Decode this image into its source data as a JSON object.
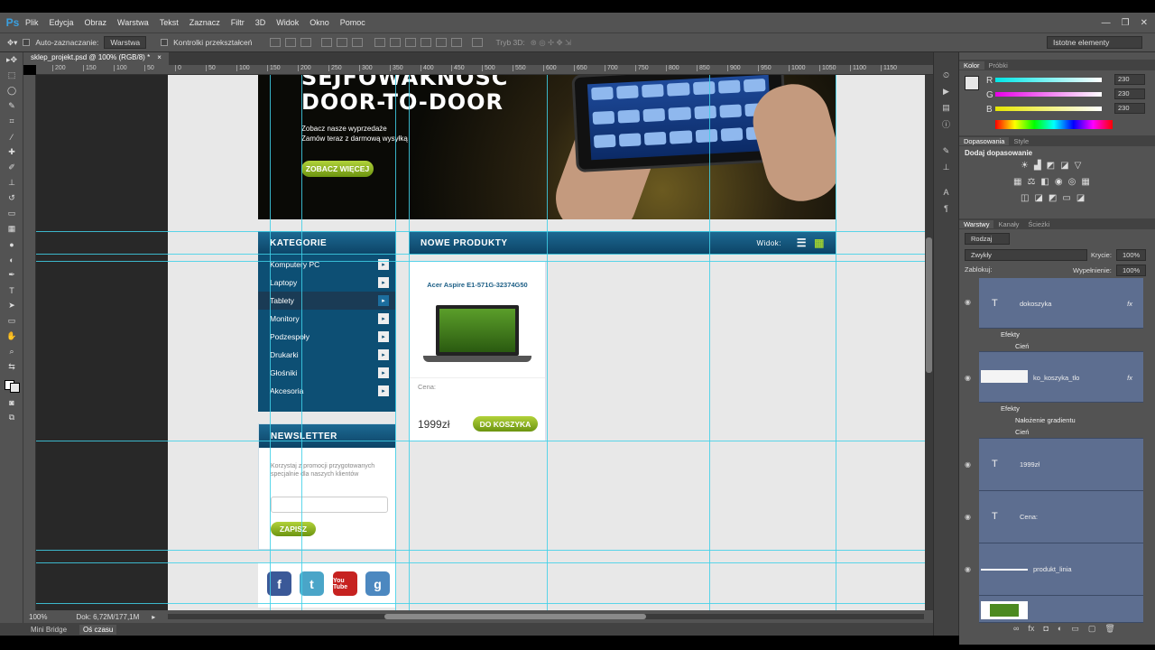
{
  "app": {
    "logo": "Ps",
    "window_controls": [
      "—",
      "❐",
      "✕"
    ]
  },
  "menu": [
    "Plik",
    "Edycja",
    "Obraz",
    "Warstwa",
    "Tekst",
    "Zaznacz",
    "Filtr",
    "3D",
    "Widok",
    "Okno",
    "Pomoc"
  ],
  "options": {
    "auto_select": "Auto-zaznaczanie:",
    "layer_select": "Warstwa",
    "transform": "Kontrolki przekształceń",
    "mode3d": "Tryb 3D:",
    "workspace": "Istotne elementy"
  },
  "document": {
    "tab_title": "sklep_projekt.psd @ 100% (RGB/8) *",
    "close": "×"
  },
  "ruler": {
    "ticks": [
      "200",
      "150",
      "100",
      "50",
      "0",
      "50",
      "100",
      "150",
      "200",
      "250",
      "300",
      "350",
      "400",
      "450",
      "500",
      "550",
      "600",
      "650",
      "700",
      "750",
      "800",
      "850",
      "900",
      "950",
      "1000",
      "1050",
      "1100",
      "1150"
    ]
  },
  "hero": {
    "headline_1": "SEJFOWAKNOŚĆ",
    "headline_2": "DOOR-TO-DOOR",
    "sub_1": "Zobacz nasze wyprzedaże",
    "sub_2": "Zamów teraz z darmową wysyłką",
    "button": "ZOBACZ WIĘCEJ"
  },
  "categories": {
    "title": "KATEGORIE",
    "items": [
      "Komputery PC",
      "Laptopy",
      "Tablety",
      "Monitory",
      "Podzespoły",
      "Drukarki",
      "Głośniki",
      "Akcesoria"
    ],
    "active": "Tablety"
  },
  "newsletter": {
    "title": "NEWSLETTER",
    "text": "Korzystaj z promocji przygotowanych specjalnie dla naszych klientów",
    "button": "ZAPISZ"
  },
  "social": [
    "f",
    "t",
    "You Tube",
    "g"
  ],
  "products": {
    "title": "NOWE PRODUKTY",
    "view_label": "Widok:",
    "item": {
      "name": "Acer Aspire E1-571G-32374G50",
      "price_label": "Cena:",
      "price": "1999zł",
      "button": "DO KOSZYKA"
    }
  },
  "status": {
    "zoom": "100%",
    "doc": "Dok: 6,72M/177,1M"
  },
  "bottom_tabs": [
    "Mini Bridge",
    "Oś czasu"
  ],
  "color_panel": {
    "tabs": [
      "Kolor",
      "Próbki"
    ],
    "r": "230",
    "g": "230",
    "b": "230",
    "labels": [
      "R",
      "G",
      "B"
    ]
  },
  "adjust_panel": {
    "tabs": [
      "Dopasowania",
      "Style"
    ],
    "heading": "Dodaj dopasowanie"
  },
  "layers_panel": {
    "tabs": [
      "Warstwy",
      "Kanały",
      "Ścieżki"
    ],
    "filter": "Rodzaj",
    "blend": "Zwykły",
    "opacity_label": "Krycie:",
    "opacity": "100%",
    "lock_label": "Zablokuj:",
    "fill_label": "Wypełnienie:",
    "fill": "100%",
    "layers": [
      {
        "name": "dokoszyka",
        "effects": [
          "Cień"
        ]
      },
      {
        "name": "ko_koszyka_tlo",
        "effects": [
          "Nałożenie gradientu",
          "Cień"
        ]
      },
      {
        "name": "1999zł"
      },
      {
        "name": "Cena:"
      },
      {
        "name": "produkt_linia"
      }
    ],
    "effects_label": "Efekty",
    "fx": "fx"
  }
}
